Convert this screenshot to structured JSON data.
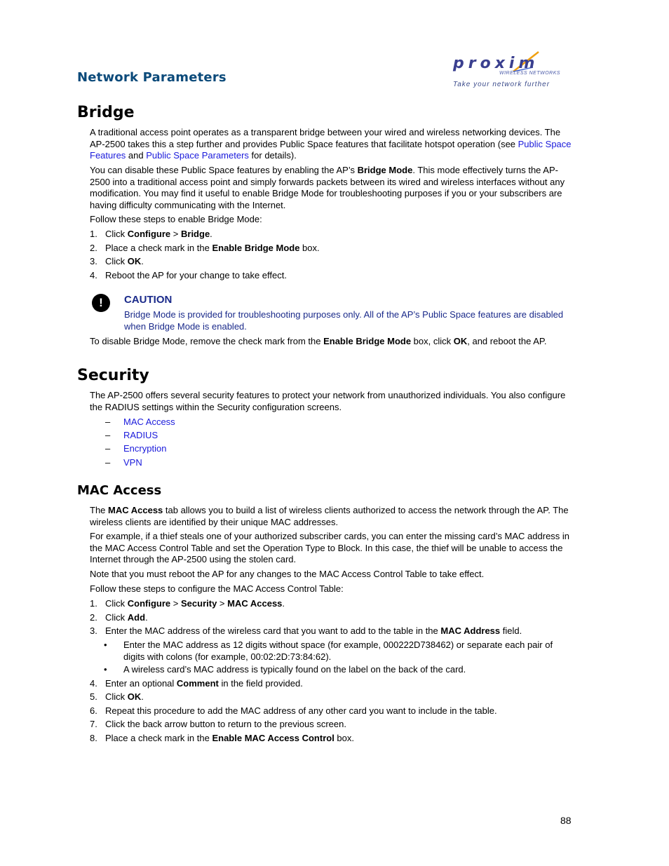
{
  "header": {
    "title": "Network Parameters",
    "logo": {
      "brand": "proxim",
      "subtitle": "WIRELESS NETWORKS",
      "tagline": "Take your network further"
    }
  },
  "bridge": {
    "heading": "Bridge",
    "p1": {
      "text1": "A traditional access point operates as a transparent bridge between your wired and wireless networking devices. The AP-2500 takes this a step further and provides Public Space features that facilitate hotspot operation (see ",
      "link1": "Public Space Features",
      "text2": " and ",
      "link2": "Public Space Parameters",
      "text3": " for details)."
    },
    "p2": {
      "text1": "You can disable these Public Space features by enabling the AP’s ",
      "bold1": "Bridge Mode",
      "text2": ". This mode effectively turns the AP-2500 into a traditional access point and simply forwards packets between its wired and wireless interfaces without any modification. You may find it useful to enable Bridge Mode for troubleshooting purposes if you or your subscribers are having difficulty communicating with the Internet."
    },
    "intro": "Follow these steps to enable Bridge Mode:",
    "steps": [
      {
        "num": "1.",
        "a": "Click ",
        "b1": "Configure",
        "c": " > ",
        "b2": "Bridge",
        "d": "."
      },
      {
        "num": "2.",
        "a": "Place a check mark in the ",
        "b1": "Enable Bridge Mode",
        "c": " box."
      },
      {
        "num": "3.",
        "a": "Click ",
        "b1": "OK",
        "c": "."
      },
      {
        "num": "4.",
        "a": "Reboot the AP for your change to take effect."
      }
    ],
    "caution": {
      "icon": "exclamation-icon",
      "title": "CAUTION",
      "text": "Bridge Mode is provided for troubleshooting purposes only. All of the AP’s Public Space features are disabled when Bridge Mode is enabled."
    },
    "disable": {
      "a": "To disable Bridge Mode, remove the check mark from the ",
      "b1": "Enable Bridge Mode",
      "c": " box, click ",
      "b2": "OK",
      "d": ", and reboot the AP."
    }
  },
  "security": {
    "heading": "Security",
    "p1": "The AP-2500 offers several security features to protect your network from unauthorized individuals. You also configure the RADIUS settings within the Security configuration screens.",
    "dash": "–",
    "links": [
      "MAC Access",
      "RADIUS",
      "Encryption",
      "VPN"
    ]
  },
  "mac_access": {
    "heading": "MAC Access",
    "p1": {
      "a": "The ",
      "b1": "MAC Access",
      "c": " tab allows you to build a list of wireless clients authorized to access the network through the AP. The wireless clients are identified by their unique MAC addresses."
    },
    "p2": "For example, if a thief steals one of your authorized subscriber cards, you can enter the missing card’s MAC address in the MAC Access Control Table and set the Operation Type to Block. In this case, the thief will be unable to access the Internet through the AP-2500 using the stolen card.",
    "p3": "Note that you must reboot the AP for any changes to the MAC Access Control Table to take effect.",
    "intro": "Follow these steps to configure the MAC Access Control Table:",
    "steps": [
      {
        "num": "1.",
        "a": "Click ",
        "b1": "Configure",
        "c": " > ",
        "b2": "Security",
        "d": " > ",
        "b3": "MAC Access",
        "e": "."
      },
      {
        "num": "2.",
        "a": "Click ",
        "b1": "Add",
        "c": "."
      },
      {
        "num": "3.",
        "a": "Enter the MAC address of the wireless card that you want to add to the table in the ",
        "b1": "MAC Address",
        "c": " field."
      },
      {
        "num": "4.",
        "a": "Enter an optional ",
        "b1": "Comment",
        "c": " in the field provided."
      },
      {
        "num": "5.",
        "a": "Click ",
        "b1": "OK",
        "c": "."
      },
      {
        "num": "6.",
        "a": "Repeat this procedure to add the MAC address of any other card you want to include in the table."
      },
      {
        "num": "7.",
        "a": "Click the back arrow button to return to the previous screen."
      },
      {
        "num": "8.",
        "a": "Place a check mark in the ",
        "b1": "Enable MAC Access Control",
        "c": " box."
      }
    ],
    "bullet": "•",
    "bullets": [
      "Enter the MAC address as 12 digits without space (for example, 000222D738462) or separate each pair of digits with colons (for example, 00:02:2D:73:84:62).",
      "A wireless card’s MAC address is typically found on the label on the back of the card."
    ]
  },
  "footer": {
    "page_number": "88"
  }
}
